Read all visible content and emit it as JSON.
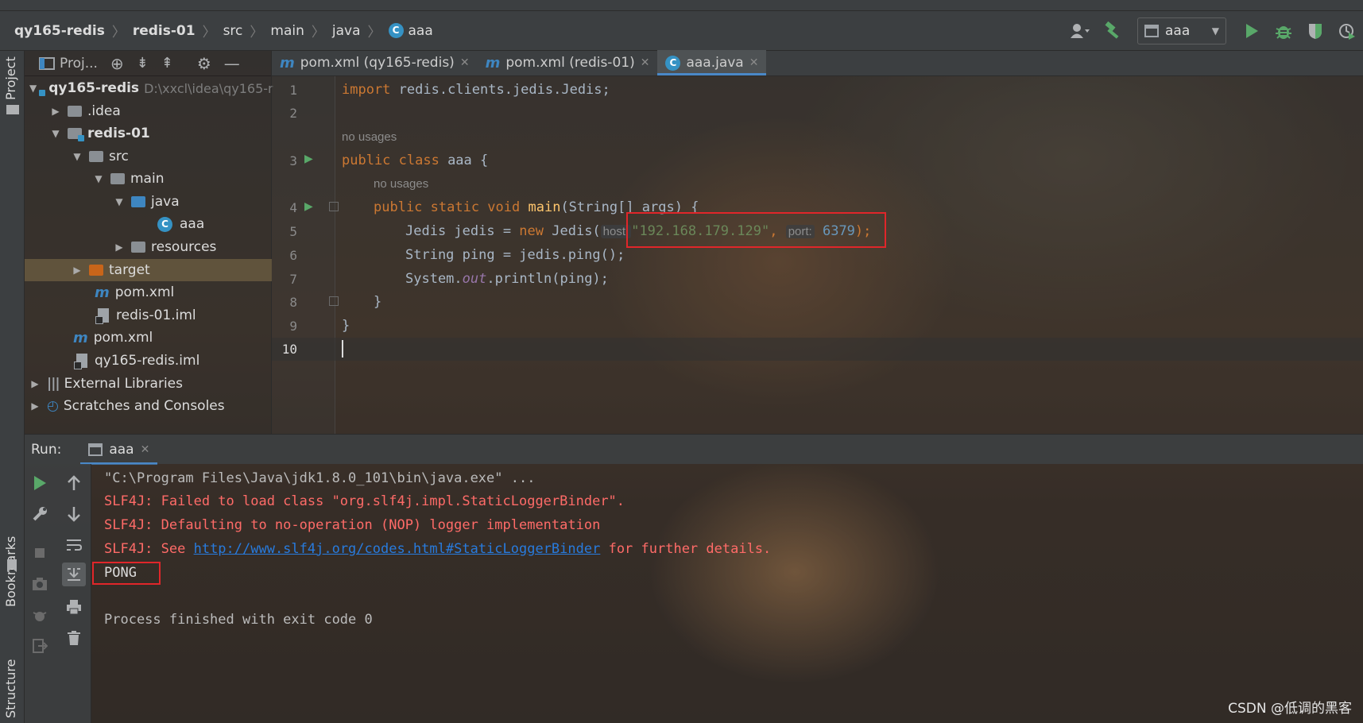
{
  "breadcrumb": {
    "items": [
      "qy165-redis",
      "redis-01",
      "src",
      "main",
      "java",
      "aaa"
    ]
  },
  "toolbar": {
    "run_config": "aaa",
    "icons": [
      "user-icon",
      "build-hammer-icon",
      "run-icon",
      "debug-icon",
      "coverage-icon",
      "profile-icon"
    ]
  },
  "left_strip": {
    "project_tab": "Project",
    "bookmarks_tab": "Bookmarks",
    "structure_tab": "Structure"
  },
  "project_panel": {
    "title": "Proj...",
    "tree": [
      {
        "label": "qy165-redis",
        "extra": "D:\\xxcl\\idea\\qy165-r"
      },
      {
        "label": ".idea"
      },
      {
        "label": "redis-01"
      },
      {
        "label": "src"
      },
      {
        "label": "main"
      },
      {
        "label": "java"
      },
      {
        "label": "aaa"
      },
      {
        "label": "resources"
      },
      {
        "label": "target"
      },
      {
        "label": "pom.xml"
      },
      {
        "label": "redis-01.iml"
      },
      {
        "label": "pom.xml"
      },
      {
        "label": "qy165-redis.iml"
      },
      {
        "label": "External Libraries"
      },
      {
        "label": "Scratches and Consoles"
      }
    ]
  },
  "editor_tabs": [
    {
      "label": "pom.xml (qy165-redis)"
    },
    {
      "label": "pom.xml (redis-01)"
    },
    {
      "label": "aaa.java"
    }
  ],
  "editor": {
    "line_numbers": [
      "1",
      "2",
      "3",
      "4",
      "5",
      "6",
      "7",
      "8",
      "9",
      "10"
    ],
    "usages_hint": "no usages",
    "code": {
      "l1_kw": "import",
      "l1_rest": " redis.clients.jedis.Jedis;",
      "l3_kw": "public class",
      "l3_rest": " aaa {",
      "l4_kw": "public static void",
      "l4_fn": "main",
      "l4_rest": "(String[] args) {",
      "l5_a": "Jedis jedis = ",
      "l5_kw": "new",
      "l5_b": " Jedis(",
      "l5_hint_host": "host:",
      "l5_str": "\"192.168.179.129\"",
      "l5_comma": ",",
      "l5_hint_port": "port:",
      "l5_num": "6379",
      "l5_end": ");",
      "l6": "String ping = jedis.ping();",
      "l7_a": "System.",
      "l7_fld": "out",
      "l7_b": ".println(ping);",
      "l8": "}",
      "l9": "}"
    }
  },
  "run_panel": {
    "label": "Run:",
    "tab": "aaa",
    "console": [
      "\"C:\\Program Files\\Java\\jdk1.8.0_101\\bin\\java.exe\" ...",
      "SLF4J: Failed to load class \"org.slf4j.impl.StaticLoggerBinder\".",
      "SLF4J: Defaulting to no-operation (NOP) logger implementation",
      "SLF4J: See ",
      "http://www.slf4j.org/codes.html#StaticLoggerBinder",
      " for further details.",
      "PONG",
      "Process finished with exit code 0"
    ]
  },
  "colors": {
    "highlight_box": "#e0262a",
    "keyword": "#cc7832",
    "string": "#6a8759",
    "number": "#6897bb"
  },
  "watermark": "CSDN @低调的黑客"
}
